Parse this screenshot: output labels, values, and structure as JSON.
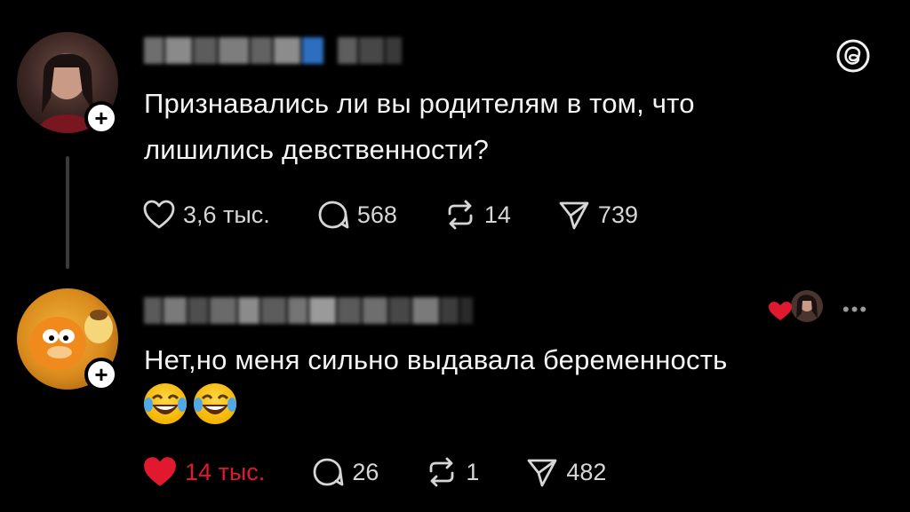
{
  "posts": [
    {
      "text_line1": "Признавались ли вы родителям в том, что",
      "text_line2": "лишились девственности?",
      "likes": "3,6 тыс.",
      "replies": "568",
      "reposts": "14",
      "shares": "739",
      "liked": false
    },
    {
      "text_line1": "Нет,но меня сильно выдавала беременность",
      "likes": "14 тыс.",
      "replies": "26",
      "reposts": "1",
      "shares": "482",
      "liked": true
    }
  ],
  "icons": {
    "follow_symbol": "+",
    "more_symbol": "•••",
    "threads_logo": "threads-logo-icon",
    "emoji": "laughing-tears-emoji"
  },
  "colors": {
    "background": "#000000",
    "text": "#f5f5f5",
    "like_active": "#e0192e",
    "muted": "#d6d6d6"
  }
}
